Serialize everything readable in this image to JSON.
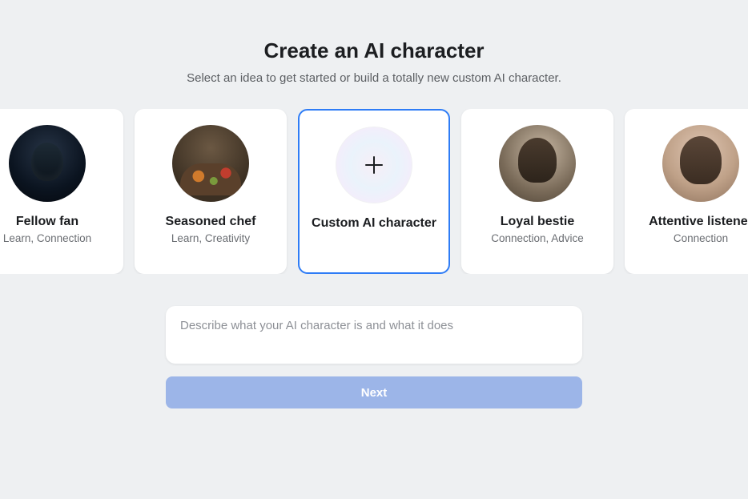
{
  "header": {
    "title": "Create an AI character",
    "subtitle": "Select an idea to get started or build a totally new custom AI character."
  },
  "cards": [
    {
      "title": "Fellow fan",
      "tags": "Learn, Connection",
      "selected": false,
      "icon": "fan-avatar"
    },
    {
      "title": "Seasoned chef",
      "tags": "Learn, Creativity",
      "selected": false,
      "icon": "chef-avatar"
    },
    {
      "title": "Custom AI character",
      "tags": "",
      "selected": true,
      "icon": "plus-icon"
    },
    {
      "title": "Loyal bestie",
      "tags": "Connection, Advice",
      "selected": false,
      "icon": "bestie-avatar"
    },
    {
      "title": "Attentive listener",
      "tags": "Connection",
      "selected": false,
      "icon": "listener-avatar"
    }
  ],
  "form": {
    "describe_placeholder": "Describe what your AI character is and what it does",
    "describe_value": "",
    "next_label": "Next"
  },
  "colors": {
    "accent": "#2e7cf6",
    "next_button_bg": "#9cb5e8",
    "page_bg": "#eef0f2"
  }
}
